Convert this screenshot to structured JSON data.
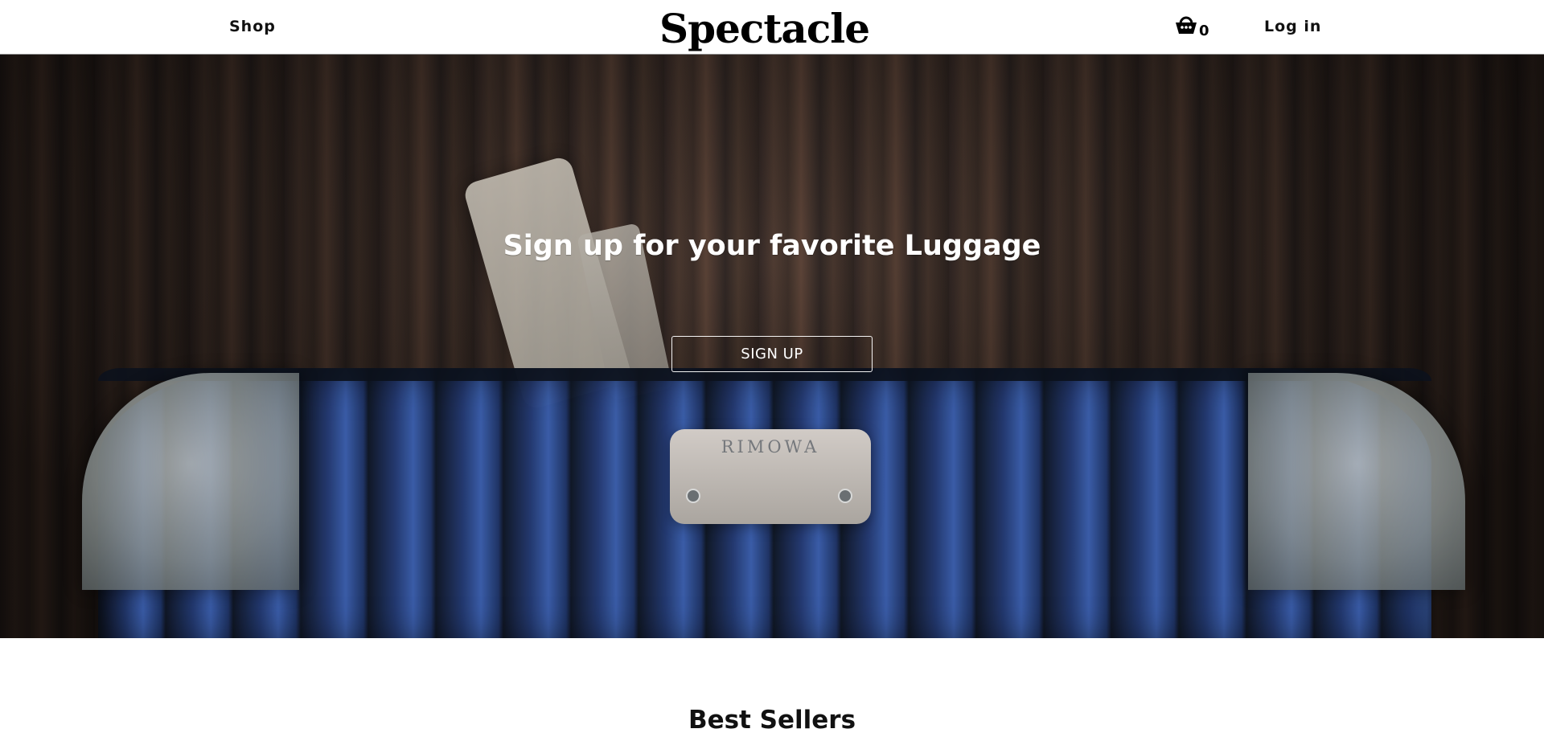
{
  "header": {
    "shop_label": "Shop",
    "brand": "Spectacle",
    "cart_icon": "basket-icon",
    "cart_count": "0",
    "login_label": "Log in"
  },
  "hero": {
    "title": "Sign up for your favorite Luggage",
    "signup_label": "SIGN UP",
    "badge_text": "RIMOWA"
  },
  "best_sellers": {
    "heading": "Best Sellers"
  }
}
